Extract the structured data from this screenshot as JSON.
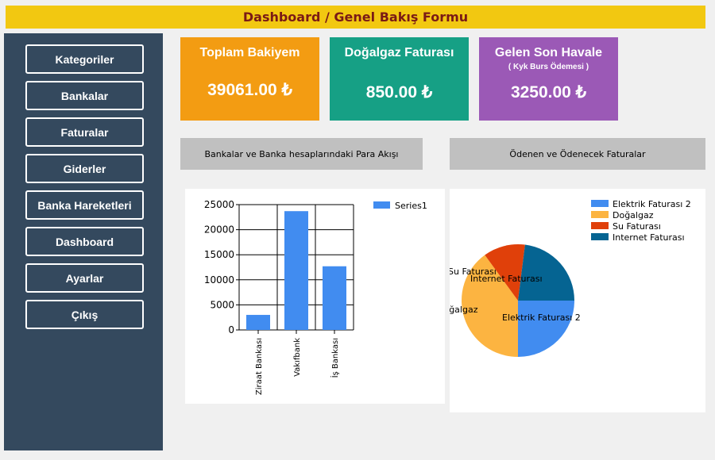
{
  "form": {
    "title": "Dashboard / Genel Bakış Formu"
  },
  "sidebar": {
    "items": [
      {
        "label": "Kategoriler"
      },
      {
        "label": "Bankalar"
      },
      {
        "label": "Faturalar"
      },
      {
        "label": "Giderler"
      },
      {
        "label": "Banka Hareketleri"
      },
      {
        "label": "Dashboard"
      },
      {
        "label": "Ayarlar"
      },
      {
        "label": "Çıkış"
      }
    ]
  },
  "cards": {
    "balance": {
      "title": "Toplam Bakiyem",
      "value": "39061.00 ₺",
      "color": "#f39c12"
    },
    "gas": {
      "title": "Doğalgaz Faturası",
      "value": "850.00 ₺",
      "color": "#16a085"
    },
    "transfer": {
      "title": "Gelen Son Havale",
      "subtitle": "( Kyk Burs Ödemesi )",
      "value": "3250.00 ₺",
      "color": "#9b59b6"
    }
  },
  "sections": {
    "banks": "Bankalar ve Banka hesaplarındaki Para Akışı",
    "bills": "Ödenen ve Ödenecek Faturalar"
  },
  "chart_data": [
    {
      "type": "bar",
      "categories": [
        "Ziraat Bankası",
        "Vakıfbank",
        "İş Bankası"
      ],
      "series": [
        {
          "name": "Series1",
          "values": [
            3000,
            23700,
            12700
          ],
          "color": "#418cf0"
        }
      ],
      "ylim": [
        0,
        25000
      ],
      "yticks": [
        0,
        5000,
        10000,
        15000,
        20000,
        25000
      ],
      "grid": true,
      "legend": "top-right"
    },
    {
      "type": "pie",
      "categories": [
        "Elektrik Faturası 2",
        "Doğalgaz",
        "Su Faturası",
        "Internet Faturası"
      ],
      "values": [
        25,
        40,
        12,
        23
      ],
      "colors": [
        "#418cf0",
        "#fcb441",
        "#e0400a",
        "#056492"
      ],
      "legend": "top-right"
    }
  ]
}
